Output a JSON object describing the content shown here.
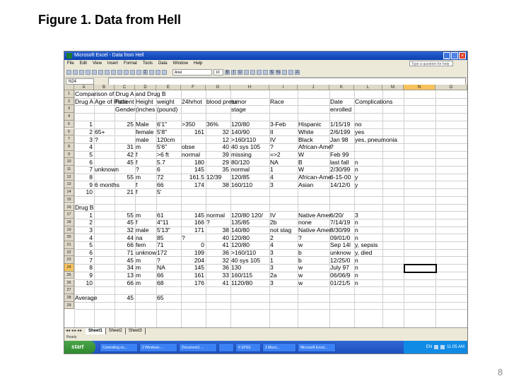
{
  "slide": {
    "title": "Figure 1.  Data from Hell",
    "page_number": "8"
  },
  "window": {
    "title": "Microsoft Excel - Data from Hell",
    "menu": [
      "File",
      "Edit",
      "View",
      "Insert",
      "Format",
      "Tools",
      "Data",
      "Window",
      "Help"
    ],
    "help_placeholder": "Type a question for help",
    "font_name": "Arial",
    "font_size": "10",
    "name_box": "N24",
    "active_column": "N",
    "active_row": "24"
  },
  "columns": [
    "A",
    "B",
    "C",
    "D",
    "E",
    "F",
    "G",
    "H",
    "I",
    "J",
    "K",
    "L",
    "M",
    "N",
    "O"
  ],
  "rows": [
    "1",
    "2",
    "3",
    "4",
    "5",
    "6",
    "7",
    "8",
    "9",
    "10",
    "11",
    "12",
    "13",
    "14",
    "15",
    "16",
    "17",
    "18",
    "19",
    "20",
    "21",
    "22",
    "23",
    "24",
    "25",
    "26",
    "27",
    "28",
    "29"
  ],
  "cells": [
    [
      "Comparison of Drug A and Drug B"
    ],
    [
      "Drug A",
      "Age of Patie",
      "Patient",
      "Height",
      "weight",
      "24hrhot",
      "blood press",
      "tumor",
      "Race",
      "",
      "Date",
      "Complications"
    ],
    [
      "",
      "",
      "Gender",
      "(inches",
      "(pound)",
      "",
      "",
      "stage",
      "",
      "",
      "enrolled",
      ""
    ],
    [],
    [
      "1",
      "",
      "25",
      "Male",
      "6'1\"",
      ">350",
      "36%",
      "120/80",
      "3-Feb",
      "Hispanic",
      "1/15/19",
      "no"
    ],
    [
      "2",
      "65+",
      "",
      "female",
      "5'8\"",
      "161",
      "32",
      "140/90",
      "II",
      "White",
      "2/6/199",
      "yes"
    ],
    [
      "3",
      "?",
      "",
      "male",
      "120cm",
      "",
      "12",
      ">160/110",
      "IV",
      "Black",
      "Jan 98",
      "yes, pneumonia"
    ],
    [
      "4",
      "",
      "31",
      "m",
      "5'6\"",
      "obse",
      "40",
      "40 sys 105",
      "?",
      "African-Ame",
      "?",
      ""
    ],
    [
      "5",
      "",
      "42",
      "f",
      ">6 ft",
      "normal",
      "39",
      "missing",
      "=>2",
      "W",
      "Feb 99",
      ""
    ],
    [
      "6",
      "",
      "45",
      "f",
      "5.7",
      "180",
      "29",
      "80/120",
      "NA",
      "B",
      "last fall",
      "n"
    ],
    [
      "7",
      "unknown",
      "",
      "?",
      "6",
      "145",
      "35",
      "normal",
      "1",
      "W",
      "2/30/99",
      "n"
    ],
    [
      "8",
      "",
      "55",
      "m",
      "72",
      "161.5",
      "12/39",
      "120/85",
      "4",
      "African-Ame",
      "6-15-00",
      "y"
    ],
    [
      "9",
      "6 months",
      "",
      "f",
      "66",
      "174",
      "38",
      "160/110",
      "3",
      "Asian",
      "14/12/0",
      "y"
    ],
    [
      "10",
      "",
      "21",
      "f",
      "5'",
      "",
      "",
      "",
      "",
      "",
      "",
      ""
    ],
    [],
    [
      "Drug B"
    ],
    [
      "1",
      "",
      "55",
      "m",
      "61",
      "145",
      "normal",
      "120/80 120/",
      "IV",
      "Native Amer",
      "6/20/",
      "3"
    ],
    [
      "2",
      "",
      "45",
      "f",
      "4\"11",
      "166",
      "?",
      "135/85",
      "2b",
      "none",
      "7/14/19",
      "n"
    ],
    [
      "3",
      "",
      "32",
      "male",
      "5'13\"",
      "171",
      "38",
      "140/80",
      "not stag",
      "Native Amer",
      "8/30/99",
      "n"
    ],
    [
      "4",
      "",
      "44",
      "na",
      "85",
      "?",
      "40",
      "120/80",
      "2",
      "?",
      "09/01/0",
      "n"
    ],
    [
      "5",
      "",
      "66",
      "fem",
      "71",
      "0",
      "41",
      "120/80",
      "4",
      "w",
      "Sep 14l",
      "y, sepsis"
    ],
    [
      "6",
      "",
      "71",
      "unknow",
      "172",
      "199",
      "36",
      ">160/110",
      "3",
      "b",
      "unknow",
      "y, died"
    ],
    [
      "7",
      "",
      "45",
      "m",
      "?",
      "204",
      "32",
      "40 sys 105",
      "1",
      "b",
      "12/25/0",
      "n"
    ],
    [
      "8",
      "",
      "34",
      "m",
      "NA",
      "145",
      "36",
      "130",
      "3",
      "w",
      "July 97",
      "n"
    ],
    [
      "9",
      "",
      "13",
      "m",
      "66",
      "161",
      "33",
      "160/115",
      "2a",
      "w",
      "06/06/9",
      "n"
    ],
    [
      "10",
      "",
      "66",
      "m",
      "68",
      "176",
      "41",
      "1120/80",
      "3",
      "w",
      "01/21/5",
      "n"
    ],
    [],
    [
      "Average",
      "",
      "45",
      "",
      "65",
      ""
    ],
    []
  ],
  "sheet_tabs": [
    "Sheet1",
    "Sheet2",
    "Sheet3"
  ],
  "status": "Ready",
  "taskbar": {
    "start": "start",
    "items": [
      "Controlling so...",
      "2 Windows ...",
      "Document1 ...",
      "",
      "6 SPSS",
      "2 Micro...",
      "Microsoft Excel...",
      "Microsoft Excel..."
    ],
    "tray_text": "EN",
    "clock": "11:05 AM"
  }
}
